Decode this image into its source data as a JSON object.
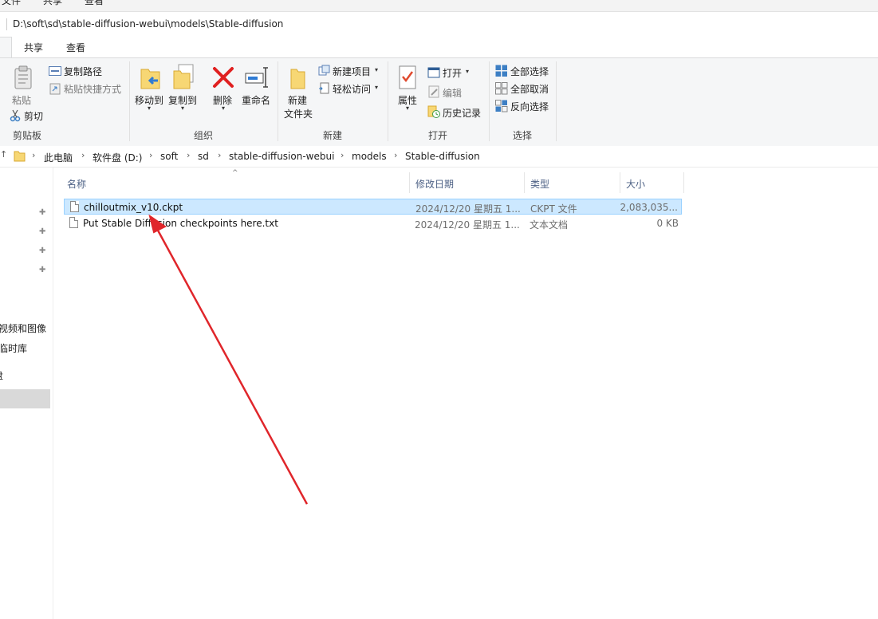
{
  "top_tabs": [
    "文件",
    "共享",
    "查看"
  ],
  "path_title": "D:\\soft\\sd\\stable-diffusion-webui\\models\\Stable-diffusion",
  "ribbon_tabs": [
    "共享",
    "查看"
  ],
  "ribbon": {
    "clipboard": {
      "paste": "粘贴",
      "copy_path": "复制路径",
      "paste_shortcut": "粘贴快捷方式",
      "cut": "剪切",
      "group": "剪贴板"
    },
    "organize": {
      "move_to": "移动到",
      "copy_to": "复制到",
      "delete": "删除",
      "rename": "重命名",
      "group": "组织"
    },
    "new": {
      "new_folder_1": "新建",
      "new_folder_2": "文件夹",
      "new_item": "新建项目",
      "easy_access": "轻松访问",
      "group": "新建"
    },
    "open": {
      "properties": "属性",
      "open": "打开",
      "edit": "编辑",
      "history": "历史记录",
      "group": "打开"
    },
    "select": {
      "select_all": "全部选择",
      "select_none": "全部取消",
      "invert": "反向选择",
      "group": "选择"
    }
  },
  "breadcrumbs": [
    "此电脑",
    "软件盘 (D:)",
    "soft",
    "sd",
    "stable-diffusion-webui",
    "models",
    "Stable-diffusion"
  ],
  "nav_items": [
    "视频和图像",
    "临时库",
    "盘"
  ],
  "columns": {
    "name": "名称",
    "date": "修改日期",
    "type": "类型",
    "size": "大小"
  },
  "files": [
    {
      "name": "chilloutmix_v10.ckpt",
      "date": "2024/12/20 星期五 1...",
      "type": "CKPT 文件",
      "size": "2,083,035...",
      "selected": true
    },
    {
      "name": "Put Stable Diffusion checkpoints here.txt",
      "date": "2024/12/20 星期五 1...",
      "type": "文本文档",
      "size": "0 KB",
      "selected": false
    }
  ],
  "colors": {
    "selection": "#cce8ff",
    "arrow": "#e0262b",
    "header_text": "#4d6185"
  },
  "icons": [
    "paste-icon",
    "copy-path-icon",
    "paste-shortcut-icon",
    "cut-icon",
    "move-to-icon",
    "copy-to-icon",
    "delete-icon",
    "rename-icon",
    "new-folder-icon",
    "new-item-icon",
    "easy-access-icon",
    "properties-icon",
    "open-icon",
    "edit-icon",
    "history-icon",
    "select-all-icon",
    "select-none-icon",
    "invert-selection-icon",
    "folder-icon",
    "pin-icon",
    "file-icon"
  ]
}
